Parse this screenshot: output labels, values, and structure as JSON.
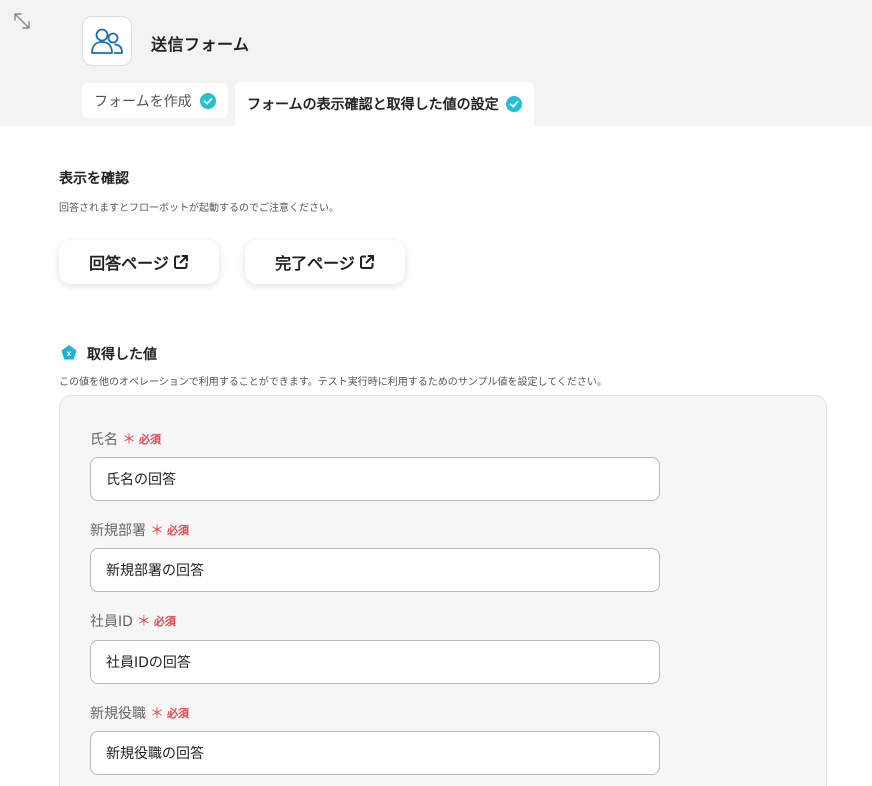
{
  "header": {
    "app_title": "送信フォーム"
  },
  "tabs": [
    {
      "label": "フォームを作成"
    },
    {
      "label": "フォームの表示確認と取得した値の設定"
    }
  ],
  "confirm": {
    "title": "表示を確認",
    "description": "回答されますとフローボットが起動するのでご注意ください。",
    "answer_page_label": "回答ページ",
    "complete_page_label": "完了ページ"
  },
  "values": {
    "title": "取得した値",
    "description": "この値を他のオペレーションで利用することができます。テスト実行時に利用するためのサンプル値を設定してください。"
  },
  "required_label": "必須",
  "required_mark": "＊",
  "fields": [
    {
      "label": "氏名",
      "value": "氏名の回答"
    },
    {
      "label": "新規部署",
      "value": "新規部署の回答"
    },
    {
      "label": "社員ID",
      "value": "社員IDの回答"
    },
    {
      "label": "新規役職",
      "value": "新規役職の回答"
    }
  ],
  "colors": {
    "accent": "#20c3d4",
    "required": "#e5484d",
    "icon_blue": "#1a6fb5"
  }
}
